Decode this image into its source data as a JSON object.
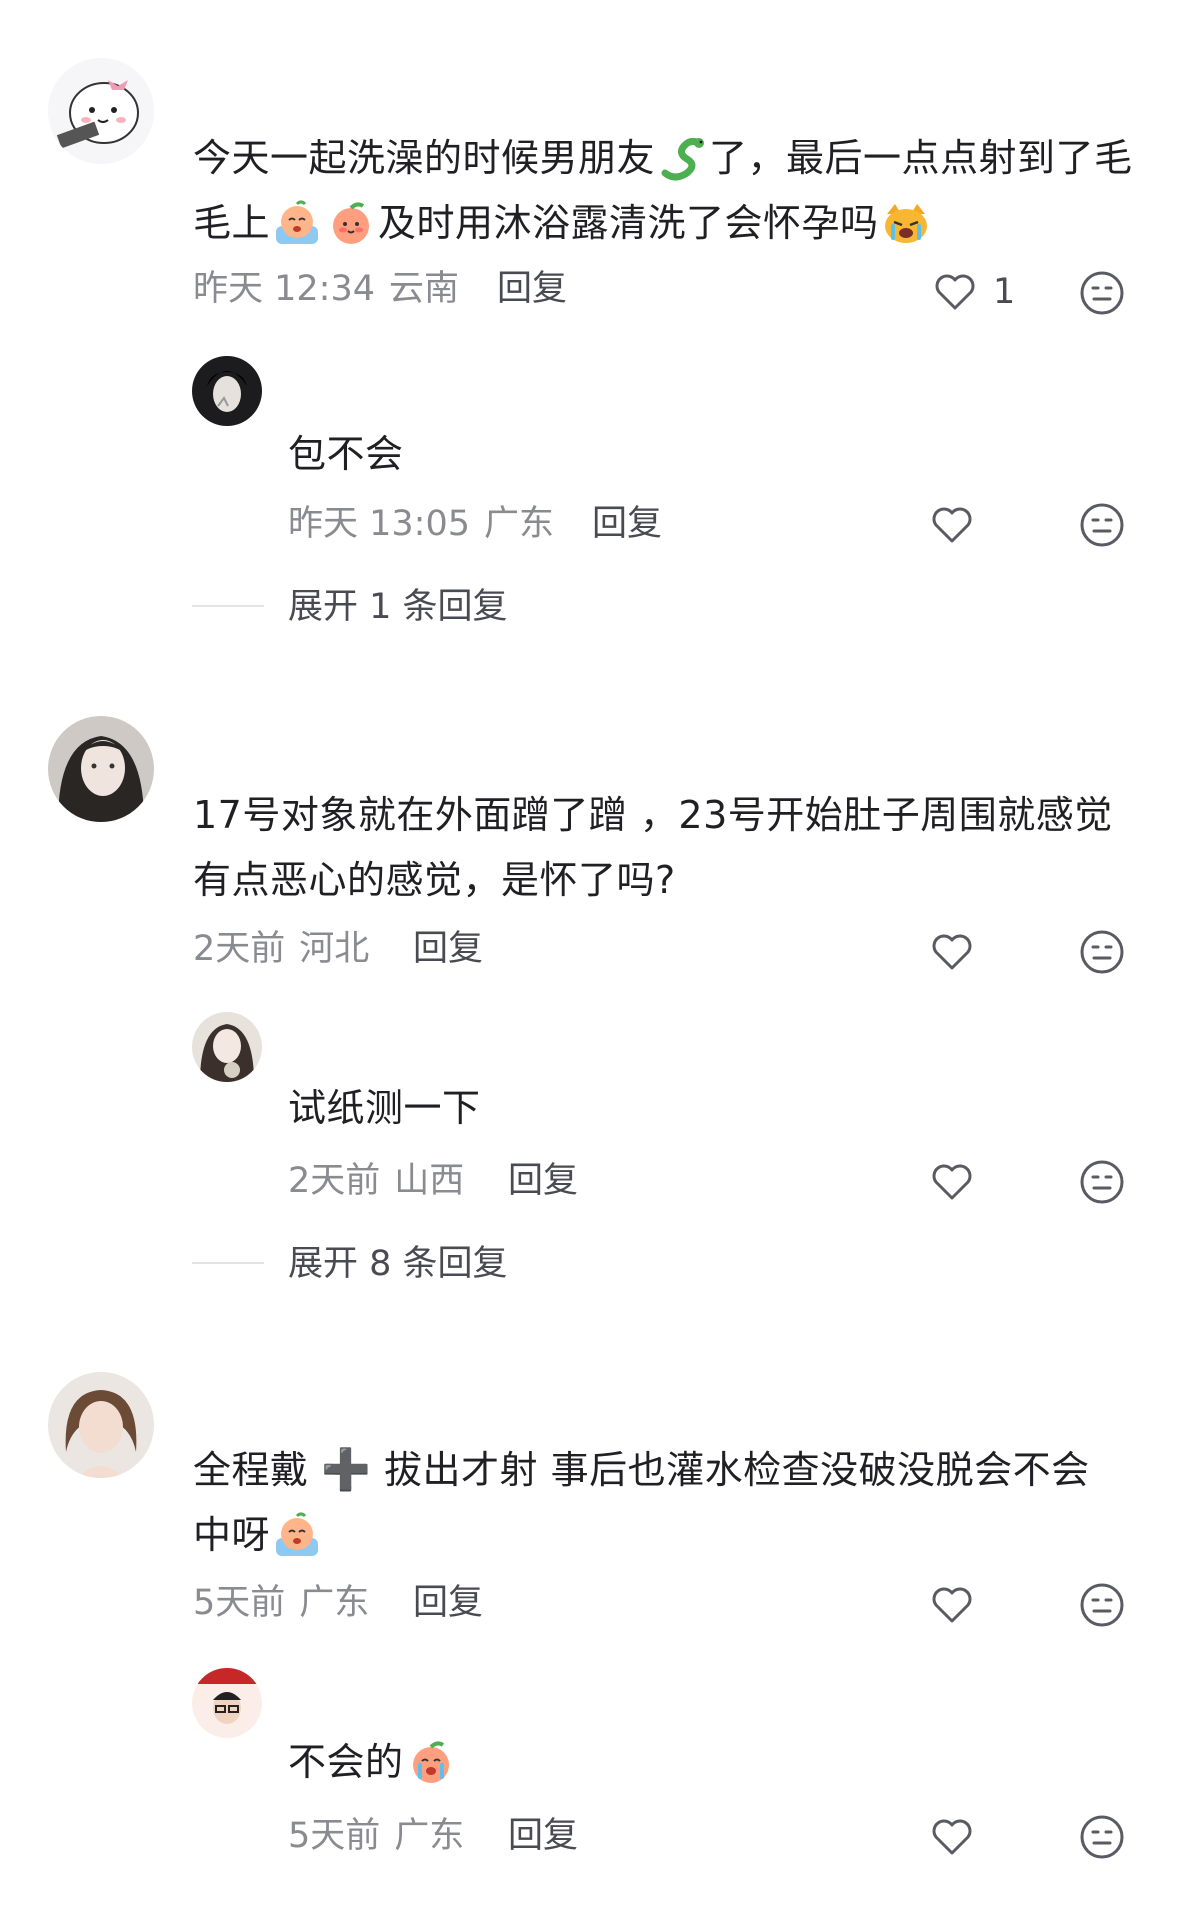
{
  "comments": [
    {
      "text_before": "今天一起洗澡的时候男朋友",
      "text_mid": "了，最后一点点射到了毛毛上",
      "text_after": "及时用沐浴露清洗了会怀孕吗",
      "time": "昨天 12:34",
      "location": "云南",
      "reply_label": "回复",
      "like_count": "1",
      "reply": {
        "text": "包不会",
        "time": "昨天 13:05",
        "location": "广东",
        "reply_label": "回复"
      },
      "expand_label": "展开 1 条回复"
    },
    {
      "text": "17号对象就在外面蹭了蹭 ，23号开始肚子周围就感觉有点恶心的感觉，是怀了吗?",
      "time": "2天前",
      "location": "河北",
      "reply_label": "回复",
      "reply": {
        "text": "试纸测一下",
        "time": "2天前",
        "location": "山西",
        "reply_label": "回复"
      },
      "expand_label": "展开 8 条回复"
    },
    {
      "text_before": "全程戴",
      "plus": "➕",
      "text_mid": "拔出才射 事后也灌水检查没破没脱会不会中呀",
      "time": "5天前",
      "location": "广东",
      "reply_label": "回复",
      "reply": {
        "text": "不会的",
        "time": "5天前",
        "location": "广东",
        "reply_label": "回复"
      }
    }
  ],
  "icons": {
    "like": "heart-outline-icon",
    "dislike": "meh-face-icon",
    "emoji_snake": "snake-emoji",
    "emoji_cry": "crying-emoji",
    "emoji_peach": "peach-emoji",
    "emoji_cat": "crying-cat-emoji"
  }
}
